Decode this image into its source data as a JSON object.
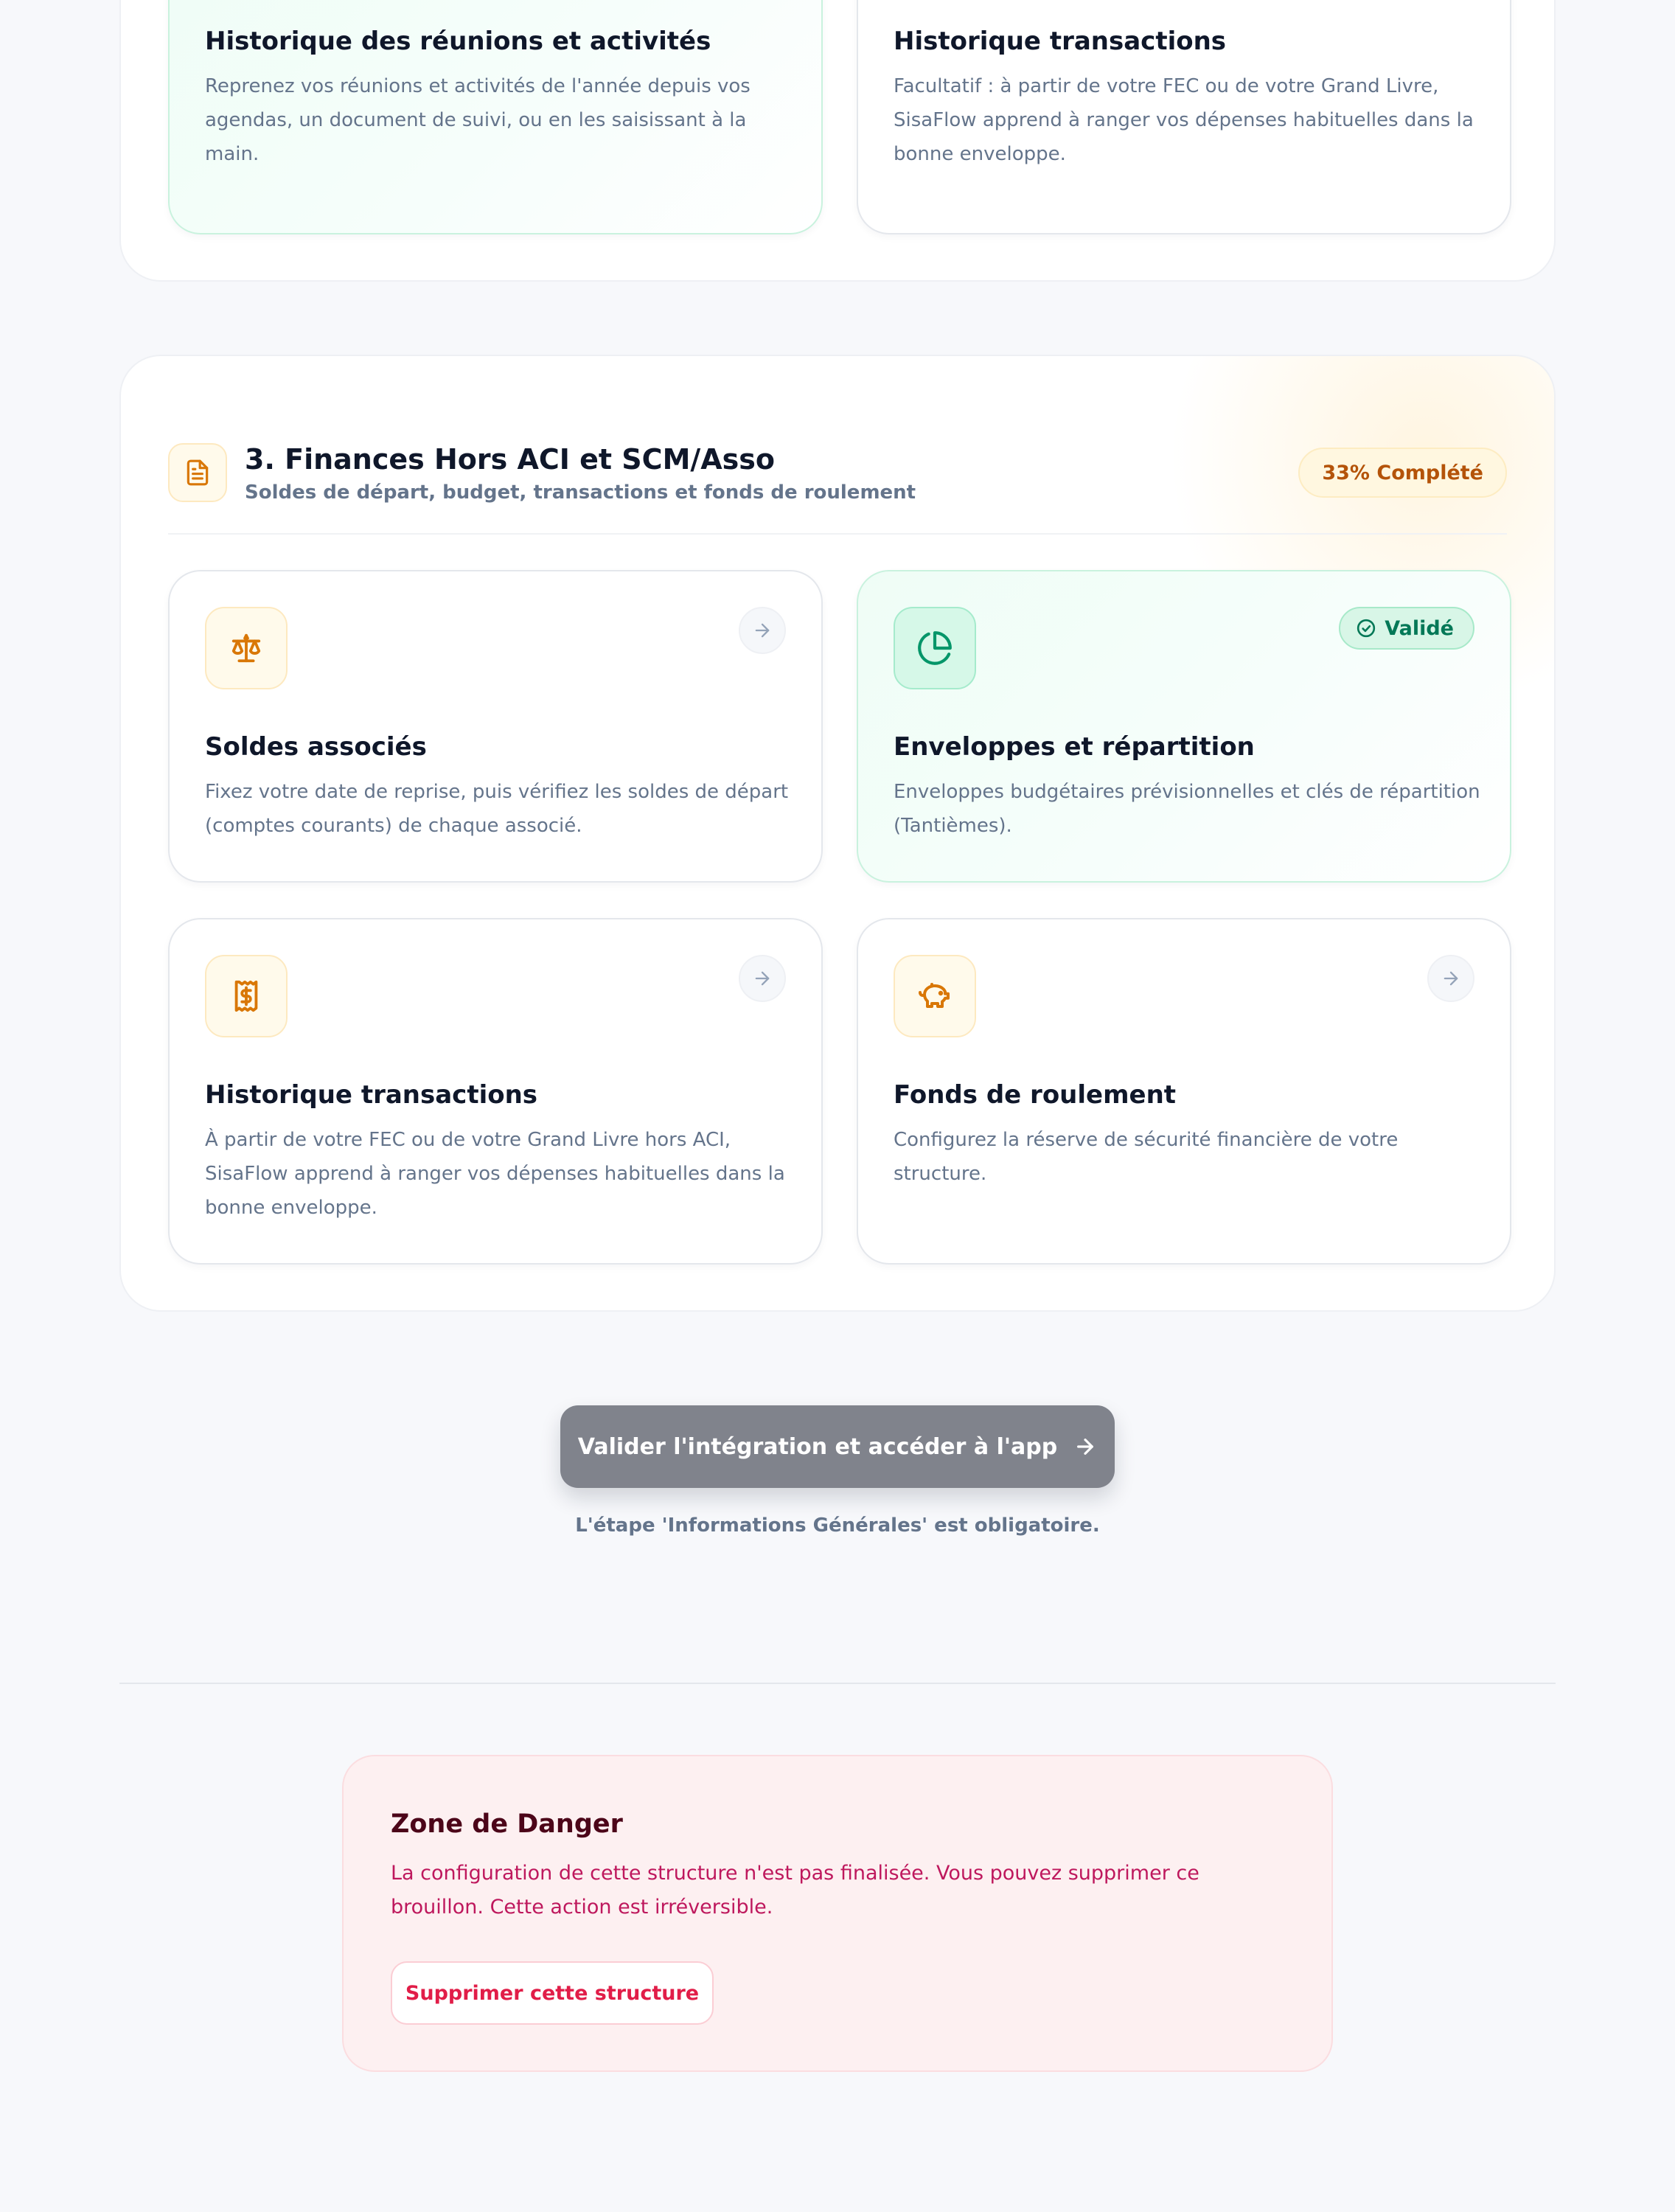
{
  "top_section": {
    "cards": [
      {
        "title": "Historique des réunions et activités",
        "description": "Reprenez vos réunions et activités de l'année depuis vos agendas, un document de suivi, ou en les saisissant à la main."
      },
      {
        "title": "Historique transactions",
        "description": "Facultatif : à partir de votre FEC ou de votre Grand Livre, SisaFlow apprend à ranger vos dépenses habituelles dans la bonne enveloppe."
      }
    ]
  },
  "finance_section": {
    "title": "3. Finances Hors ACI et SCM/Asso",
    "subtitle": "Soldes de départ, budget, transactions et fonds de roulement",
    "progress_label": "33% Complété",
    "cards": [
      {
        "icon": "scale-icon",
        "title": "Soldes associés",
        "description": "Fixez votre date de reprise, puis vérifiez les soldes de départ (comptes courants) de chaque associé.",
        "status": "pending"
      },
      {
        "icon": "pie-chart-icon",
        "title": "Enveloppes et répartition",
        "description": "Enveloppes budgétaires prévisionnelles et clés de répartition (Tantièmes).",
        "status": "validated",
        "badge_label": "Validé"
      },
      {
        "icon": "receipt-dollar-icon",
        "title": "Historique transactions",
        "description": "À partir de votre FEC ou de votre Grand Livre hors ACI, SisaFlow apprend à ranger vos dépenses habituelles dans la bonne enveloppe.",
        "status": "pending"
      },
      {
        "icon": "piggy-bank-icon",
        "title": "Fonds de roulement",
        "description": "Configurez la réserve de sécurité financière de votre structure.",
        "status": "pending"
      }
    ]
  },
  "cta": {
    "label": "Valider l'intégration et accéder à l'app",
    "note": "L'étape 'Informations Générales' est obligatoire."
  },
  "danger_zone": {
    "title": "Zone de Danger",
    "description": "La configuration de cette structure n'est pas finalisée. Vous pouvez supprimer ce brouillon. Cette action est irréversible.",
    "button_label": "Supprimer cette structure"
  },
  "colors": {
    "amber_accent": "#d97706",
    "green_accent": "#059669",
    "danger_accent": "#e11d48",
    "cta_disabled": "#80838c"
  }
}
